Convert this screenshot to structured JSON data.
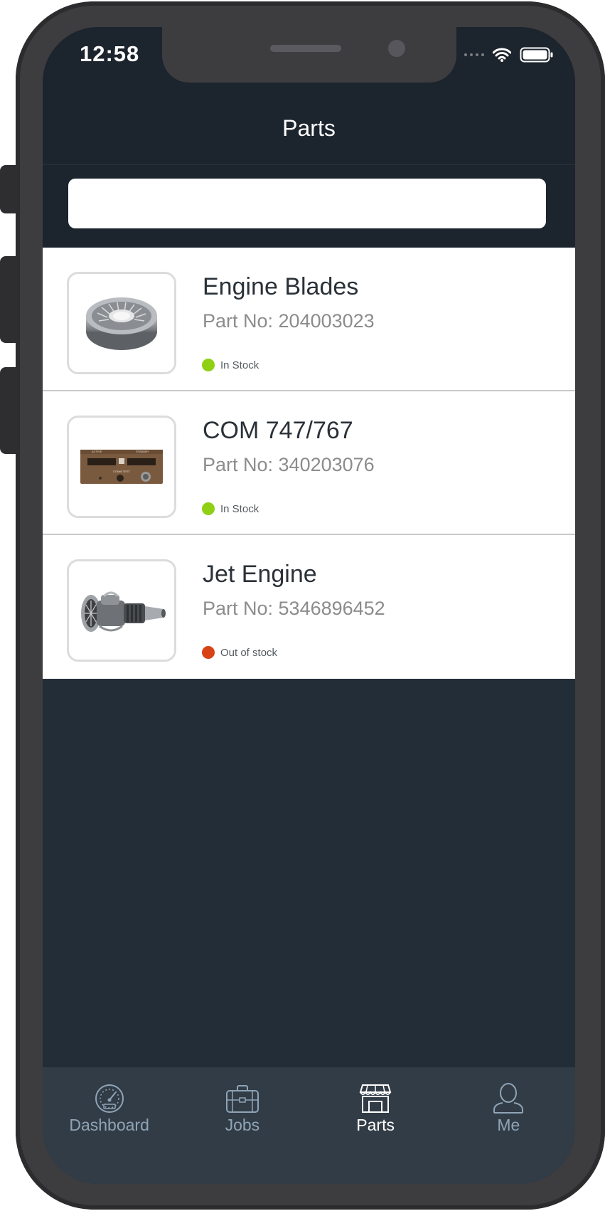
{
  "status_bar": {
    "time": "12:58"
  },
  "header": {
    "title": "Parts"
  },
  "search": {
    "value": "",
    "placeholder": ""
  },
  "parts": [
    {
      "name": "Engine Blades",
      "part_no": "Part No: 204003023",
      "stock": "In Stock",
      "stock_color": "#8fd014",
      "image": "engine-blades"
    },
    {
      "name": "COM 747/767",
      "part_no": "Part No: 340203076",
      "stock": "In Stock",
      "stock_color": "#8fd014",
      "image": "com-radio-panel"
    },
    {
      "name": "Jet Engine",
      "part_no": "Part No: 5346896452",
      "stock": "Out of stock",
      "stock_color": "#d84315",
      "image": "jet-engine"
    }
  ],
  "tabbar": {
    "items": [
      {
        "label": "Dashboard",
        "icon": "speedometer-icon",
        "active": false
      },
      {
        "label": "Jobs",
        "icon": "briefcase-icon",
        "active": false
      },
      {
        "label": "Parts",
        "icon": "storefront-icon",
        "active": true
      },
      {
        "label": "Me",
        "icon": "user-icon",
        "active": false
      }
    ]
  },
  "colors": {
    "header_bg": "#1c242d",
    "body_bg": "#232d37",
    "tabbar_bg": "#323c46",
    "tab_inactive": "#8fa4b6",
    "tab_active": "#ffffff",
    "in_stock": "#8fd014",
    "out_of_stock": "#d84315"
  }
}
